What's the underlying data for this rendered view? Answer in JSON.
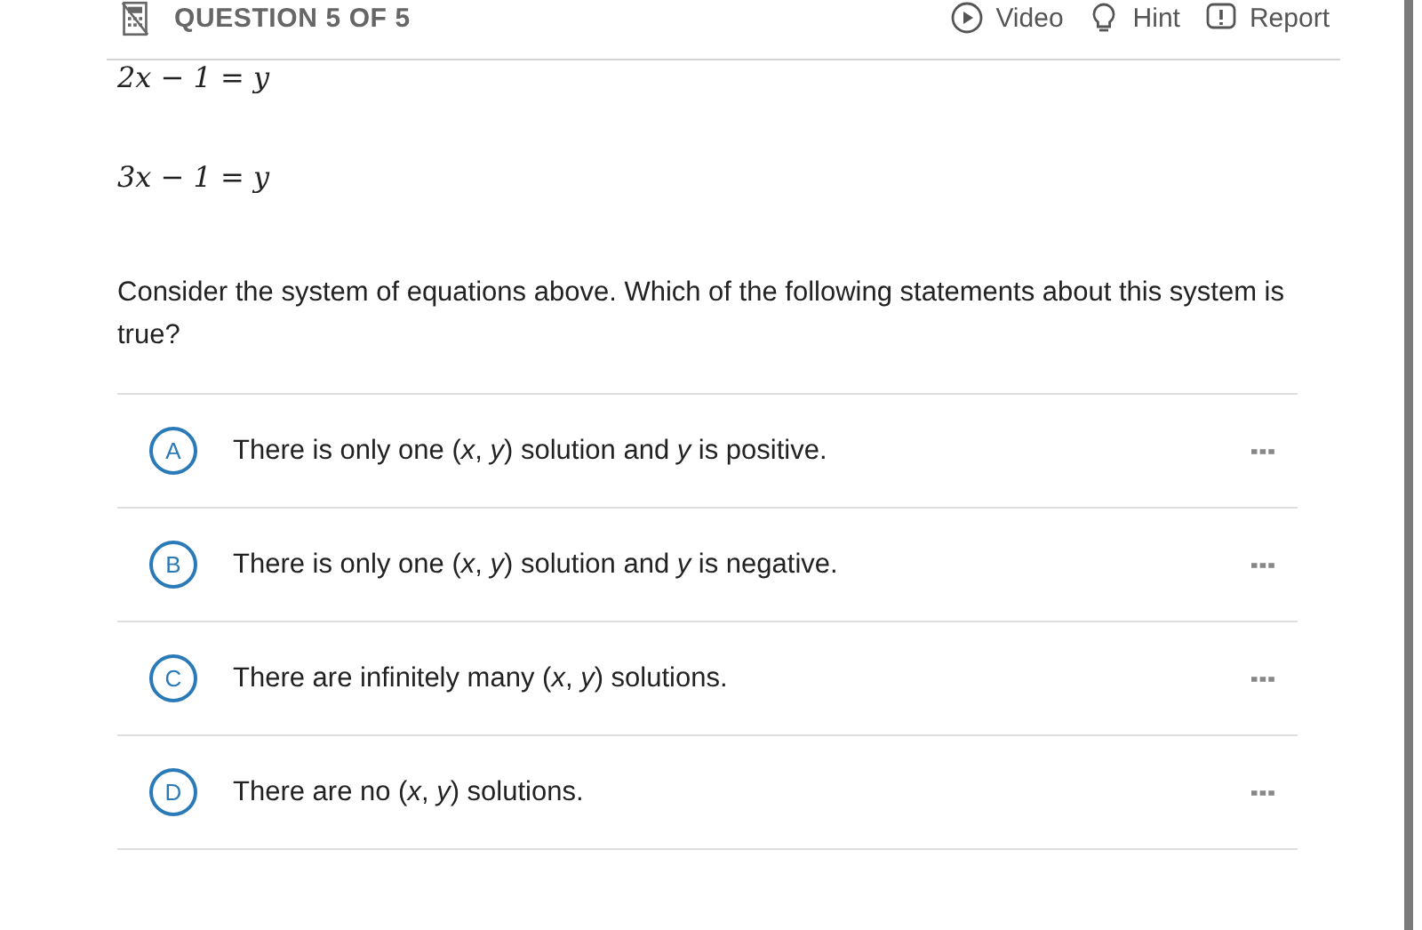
{
  "header": {
    "title": "QUESTION 5 OF 5",
    "actions": [
      {
        "kind": "video",
        "label": "Video"
      },
      {
        "kind": "hint",
        "label": "Hint"
      },
      {
        "kind": "report",
        "label": "Report"
      }
    ]
  },
  "equations": [
    "2x − 1 = y",
    "3x − 1 = y"
  ],
  "prompt": "Consider the system of equations above. Which of the following statements about this system is true?",
  "choices": [
    {
      "letter": "A",
      "text": "There is only one (*x*, *y*) solution and *y* is positive.",
      "selected": false
    },
    {
      "letter": "B",
      "text": "There is only one (*x*, *y*) solution and *y* is negative.",
      "selected": false
    },
    {
      "letter": "C",
      "text": "There are infinitely many (*x*, *y*) solutions.",
      "selected": false
    },
    {
      "letter": "D",
      "text": "There are no (*x*, *y*) solutions.",
      "selected": false
    }
  ]
}
